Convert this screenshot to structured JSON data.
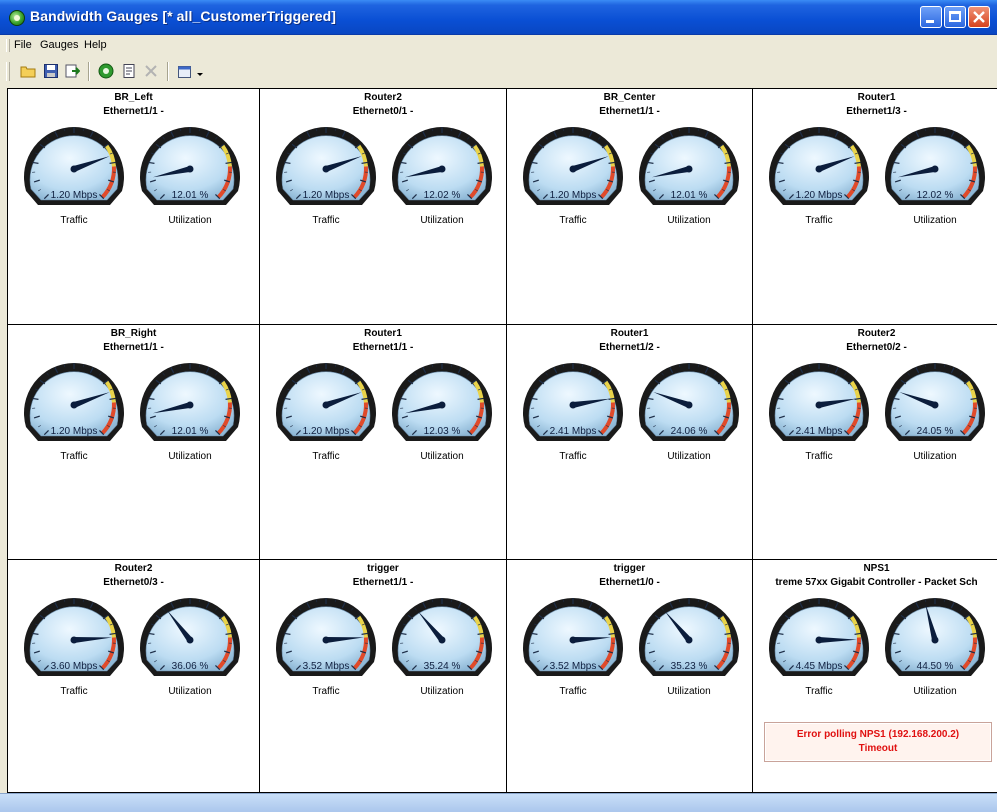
{
  "window": {
    "title": "Bandwidth Gauges [* all_CustomerTriggered]"
  },
  "menu": [
    "File",
    "Gauges",
    "Help"
  ],
  "toolbar": {
    "buttons": [
      "open-folder-icon",
      "save-icon",
      "import-icon",
      "refresh-icon",
      "properties-icon",
      "delete-icon",
      "tile-icon"
    ]
  },
  "gauges": [
    {
      "device": "BR_Left",
      "interface": "Ethernet1/1 -",
      "traffic": "1.20 Mbps",
      "utilization": "12.01 %",
      "traffic_label": "Traffic",
      "util_label": "Utilization"
    },
    {
      "device": "Router2",
      "interface": "Ethernet0/1 -",
      "traffic": "1.20 Mbps",
      "utilization": "12.02 %",
      "traffic_label": "Traffic",
      "util_label": "Utilization"
    },
    {
      "device": "BR_Center",
      "interface": "Ethernet1/1 -",
      "traffic": "1.20 Mbps",
      "utilization": "12.01 %",
      "traffic_label": "Traffic",
      "util_label": "Utilization"
    },
    {
      "device": "Router1",
      "interface": "Ethernet1/3 -",
      "traffic": "1.20 Mbps",
      "utilization": "12.02 %",
      "traffic_label": "Traffic",
      "util_label": "Utilization"
    },
    {
      "device": "BR_Right",
      "interface": "Ethernet1/1 -",
      "traffic": "1.20 Mbps",
      "utilization": "12.01 %",
      "traffic_label": "Traffic",
      "util_label": "Utilization"
    },
    {
      "device": "Router1",
      "interface": "Ethernet1/1 -",
      "traffic": "1.20 Mbps",
      "utilization": "12.03 %",
      "traffic_label": "Traffic",
      "util_label": "Utilization"
    },
    {
      "device": "Router1",
      "interface": "Ethernet1/2 -",
      "traffic": "2.41 Mbps",
      "utilization": "24.06 %",
      "traffic_label": "Traffic",
      "util_label": "Utilization"
    },
    {
      "device": "Router2",
      "interface": "Ethernet0/2 -",
      "traffic": "2.41 Mbps",
      "utilization": "24.05 %",
      "traffic_label": "Traffic",
      "util_label": "Utilization"
    },
    {
      "device": "Router2",
      "interface": "Ethernet0/3 -",
      "traffic": "3.60 Mbps",
      "utilization": "36.06 %",
      "traffic_label": "Traffic",
      "util_label": "Utilization"
    },
    {
      "device": "trigger",
      "interface": "Ethernet1/1 -",
      "traffic": "3.52 Mbps",
      "utilization": "35.24 %",
      "traffic_label": "Traffic",
      "util_label": "Utilization"
    },
    {
      "device": "trigger",
      "interface": "Ethernet1/0 -",
      "traffic": "3.52 Mbps",
      "utilization": "35.23 %",
      "traffic_label": "Traffic",
      "util_label": "Utilization"
    },
    {
      "device": "NPS1",
      "interface": "treme 57xx Gigabit Controller - Packet Sch",
      "traffic": "4.45 Mbps",
      "utilization": "44.50 %",
      "traffic_label": "Traffic",
      "util_label": "Utilization"
    }
  ],
  "error": {
    "line1": "Error polling NPS1 (192.168.200.2)",
    "line2": "Timeout"
  },
  "colors": {
    "title_bar": "#0a4fd4",
    "gauge_face": "#cde6f7",
    "needle": "#0b1d3c",
    "error_text": "#e01010"
  }
}
